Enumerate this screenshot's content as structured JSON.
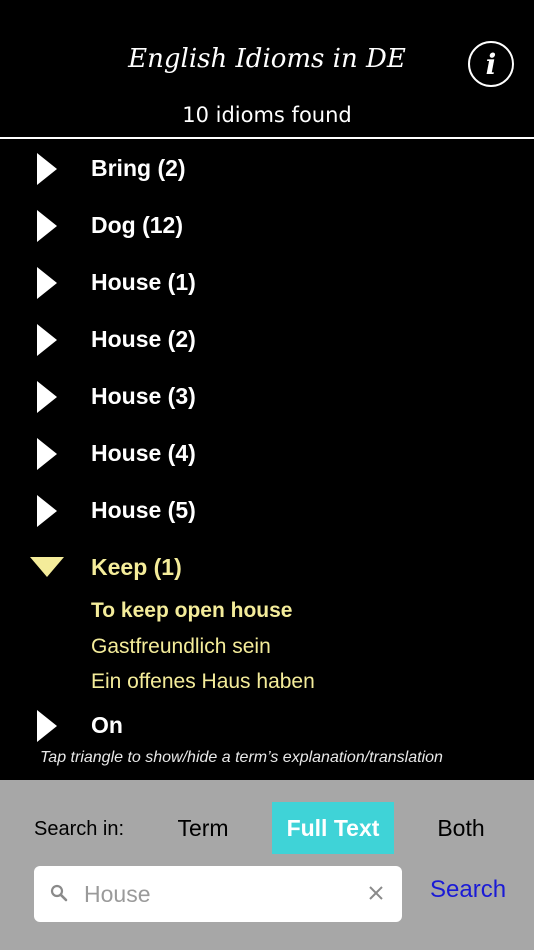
{
  "header": {
    "title": "English Idioms in DE",
    "info_label": "i",
    "count_text": "10 idioms found"
  },
  "list": {
    "items": [
      {
        "label": "Bring (2)",
        "expanded": false
      },
      {
        "label": "Dog (12)",
        "expanded": false
      },
      {
        "label": "House (1)",
        "expanded": false
      },
      {
        "label": "House (2)",
        "expanded": false
      },
      {
        "label": "House (3)",
        "expanded": false
      },
      {
        "label": "House (4)",
        "expanded": false
      },
      {
        "label": "House (5)",
        "expanded": false
      },
      {
        "label": "Keep (1)",
        "expanded": true
      },
      {
        "label": "On",
        "expanded": false
      }
    ],
    "expanded_detail": {
      "term": "To keep open house",
      "explanation": "Gastfreundlich sein",
      "translation": "Ein offenes Haus haben"
    }
  },
  "hint": "Tap triangle to show/hide a term’s explanation/translation",
  "search_panel": {
    "search_in_label": "Search in:",
    "segments": [
      "Term",
      "Full Text",
      "Both"
    ],
    "selected_segment": "Full Text",
    "input_value": "House",
    "search_button": "Search"
  },
  "colors": {
    "background": "#000000",
    "expanded_text": "#f4ec9a",
    "selected_segment": "#3fd3d7",
    "panel": "#a7a7a7",
    "link": "#1a1ad6"
  }
}
